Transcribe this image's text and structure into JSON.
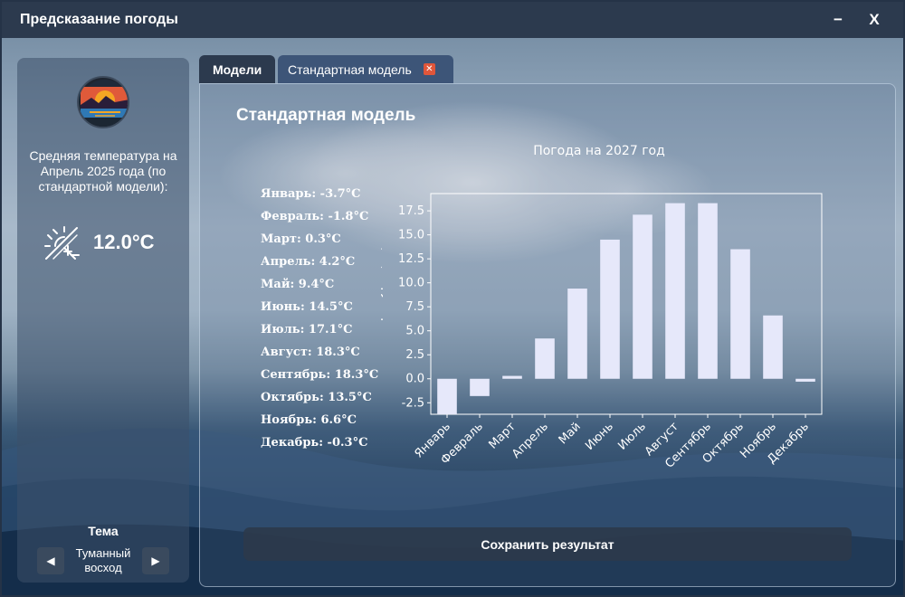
{
  "window": {
    "title": "Предсказание погоды",
    "minimize_label": "−",
    "close_label": "X"
  },
  "sidebar": {
    "avg_temp_label": "Средняя температура на Апрель 2025 года (по стандартной модели):",
    "avg_temp_value": "12.0°C",
    "theme_label": "Тема",
    "theme_name": "Туманный восход",
    "prev_theme": "◀",
    "next_theme": "▶"
  },
  "tabs": [
    {
      "label": "Модели"
    },
    {
      "label": "Стандартная модель",
      "close": "✕"
    }
  ],
  "main": {
    "title": "Стандартная модель",
    "months": [
      "Январь: -3.7°C",
      "Февраль: -1.8°C",
      "Март: 0.3°C",
      "Апрель: 4.2°C",
      "Май: 9.4°C",
      "Июнь: 14.5°C",
      "Июль: 17.1°C",
      "Август: 18.3°C",
      "Сентябрь: 18.3°C",
      "Октябрь: 13.5°C",
      "Ноябрь: 6.6°C",
      "Декабрь: -0.3°C"
    ],
    "save_button": "Сохранить результат"
  },
  "chart_data": {
    "type": "bar",
    "title": "Погода на 2027 год",
    "xlabel": "",
    "ylabel": "Температура (°C)",
    "categories": [
      "Январь",
      "Февраль",
      "Март",
      "Апрель",
      "Май",
      "Июнь",
      "Июль",
      "Август",
      "Сентябрь",
      "Октябрь",
      "Ноябрь",
      "Декабрь"
    ],
    "values": [
      -3.7,
      -1.8,
      0.3,
      4.2,
      9.4,
      14.5,
      17.1,
      18.3,
      18.3,
      13.5,
      6.6,
      -0.3
    ],
    "yticks": [
      -2.5,
      0.0,
      2.5,
      5.0,
      7.5,
      10.0,
      12.5,
      15.0,
      17.5
    ],
    "ylim": [
      -3.7,
      19.3
    ],
    "bar_color": "#e6e8fa",
    "grid": false,
    "legend": "none"
  },
  "colors": {
    "titlebar": "#2c3a4e",
    "tab_active": "#3d5578",
    "tab_close": "#e0563a"
  },
  "icons": {
    "logo": "sunset-lake-logo",
    "temperature": "sun-snowflake-icon",
    "tab_close": "close-icon"
  }
}
